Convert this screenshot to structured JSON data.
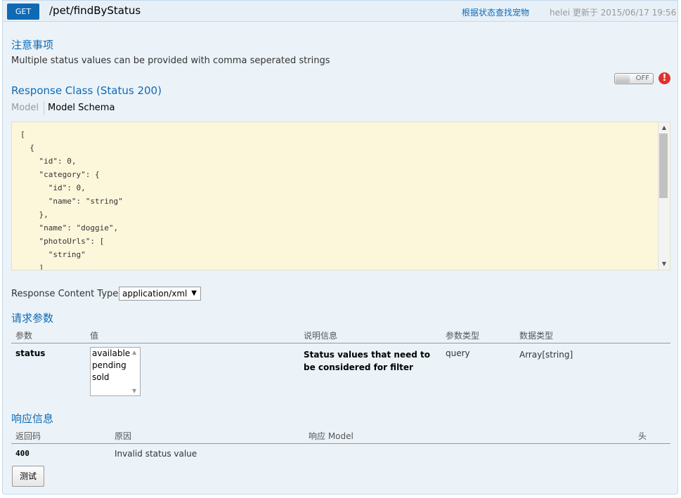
{
  "operation": {
    "method": "GET",
    "path": "/pet/findByStatus",
    "summary": "根据状态查找宠物",
    "meta": "helei 更新于 2015/06/17 19:56"
  },
  "notes": {
    "title": "注意事项",
    "text": "Multiple status values can be provided with comma seperated strings"
  },
  "toggle": {
    "label": "OFF",
    "state": "off",
    "warning_icon": "error-icon"
  },
  "response_class": {
    "title": "Response Class (Status 200)",
    "tabs": [
      "Model",
      "Model Schema"
    ],
    "active_tab": "Model Schema",
    "schema_lines": [
      "[",
      "  {",
      "    \"id\": 0,",
      "    \"category\": {",
      "      \"id\": 0,",
      "      \"name\": \"string\"",
      "    },",
      "    \"name\": \"doggie\",",
      "    \"photoUrls\": [",
      "      \"string\"",
      "    ]"
    ]
  },
  "response_content_type": {
    "label": "Response Content Type",
    "selected": "application/xml"
  },
  "parameters": {
    "title": "请求参数",
    "columns": [
      "参数",
      "值",
      "说明信息",
      "参数类型",
      "数据类型"
    ],
    "rows": [
      {
        "name": "status",
        "options": [
          "available",
          "pending",
          "sold"
        ],
        "description": "Status values that need to be considered for filter",
        "param_type": "query",
        "data_type": "Array[string]"
      }
    ]
  },
  "responses": {
    "title": "响应信息",
    "columns": [
      "返回码",
      "原因",
      "响应 Model",
      "头"
    ],
    "rows": [
      {
        "code": "400",
        "reason": "Invalid status value",
        "model": "",
        "headers": ""
      }
    ]
  },
  "try_button": "测试",
  "colors": {
    "accent": "#0f6ab4",
    "schema_bg": "#fcf6db",
    "panel_bg": "#ebf3f9",
    "error": "#e0312c"
  }
}
